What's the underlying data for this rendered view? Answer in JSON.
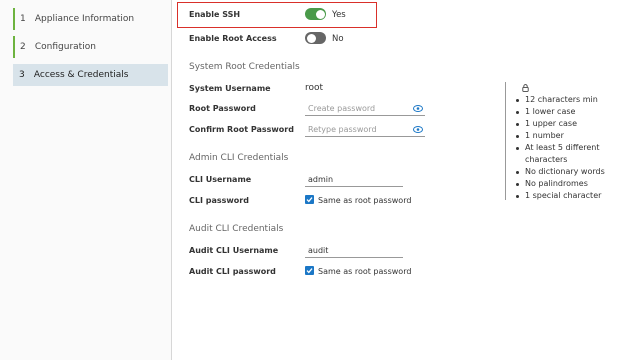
{
  "sidebar": {
    "steps": [
      {
        "num": "1",
        "label": "Appliance Information"
      },
      {
        "num": "2",
        "label": "Configuration"
      },
      {
        "num": "3",
        "label": "Access & Credentials"
      }
    ]
  },
  "ssh": {
    "label": "Enable SSH",
    "state": "Yes"
  },
  "root_access": {
    "label": "Enable Root Access",
    "state": "No"
  },
  "system_root": {
    "title": "System Root Credentials",
    "username_label": "System Username",
    "username_value": "root",
    "password_label": "Root Password",
    "password_placeholder": "Create password",
    "confirm_label": "Confirm Root Password",
    "confirm_placeholder": "Retype password"
  },
  "admin_cli": {
    "title": "Admin CLI Credentials",
    "username_label": "CLI Username",
    "username_value": "admin",
    "password_label": "CLI password",
    "same_as_root": "Same as root password"
  },
  "audit_cli": {
    "title": "Audit CLI Credentials",
    "username_label": "Audit CLI Username",
    "username_value": "audit",
    "password_label": "Audit CLI password",
    "same_as_root": "Same as root password"
  },
  "requirements": {
    "items": [
      "12 characters min",
      "1 lower case",
      "1 upper case",
      "1 number",
      "At least 5 different characters",
      "No dictionary words",
      "No palindromes",
      "1 special character"
    ]
  },
  "colors": {
    "accent_blue": "#1b77c6",
    "toggle_on": "#4a9a4a",
    "highlight_red": "#d9302a",
    "step_done": "#6db33f"
  }
}
